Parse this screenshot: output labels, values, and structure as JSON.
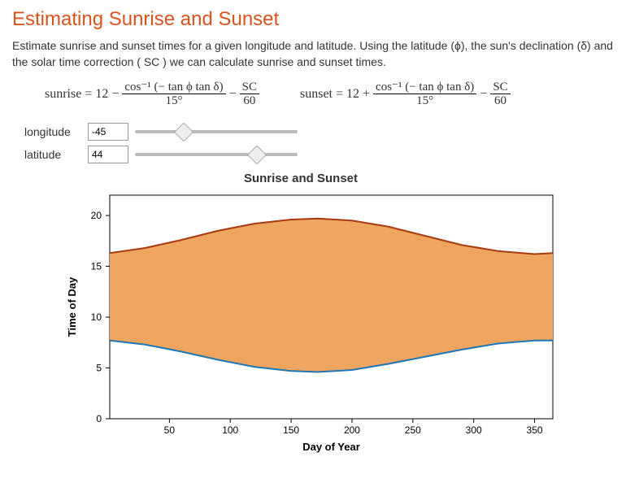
{
  "title": "Estimating Sunrise and Sunset",
  "description": "Estimate sunrise and sunset times for a given longitude and latitude.  Using the  latitude (ϕ), the sun's declination (δ) and the solar time correction ( SC ) we can calculate sunrise and sunset times.",
  "formula_sunrise_lhs": "sunrise = 12 −",
  "formula_sunset_lhs": "sunset = 12 +",
  "formula_frac1_num": "cos⁻¹ (− tan ϕ tan δ)",
  "formula_frac1_den": "15°",
  "formula_minus": "−",
  "formula_frac2_num": "SC",
  "formula_frac2_den": "60",
  "controls": {
    "longitude_label": "longitude",
    "longitude_value": "-45",
    "longitude_slider_pos": 30,
    "latitude_label": "latitude",
    "latitude_value": "44",
    "latitude_slider_pos": 75
  },
  "chart_data": {
    "type": "area",
    "title": "Sunrise and Sunset",
    "xlabel": "Day of Year",
    "ylabel": "Time of Day",
    "xlim": [
      1,
      365
    ],
    "ylim": [
      0,
      22
    ],
    "xticks": [
      50,
      100,
      150,
      200,
      250,
      300,
      350
    ],
    "yticks": [
      0,
      5,
      10,
      15,
      20
    ],
    "series": [
      {
        "name": "sunset",
        "color": "#a83a11",
        "x": [
          1,
          30,
          60,
          90,
          120,
          150,
          172,
          200,
          230,
          260,
          290,
          320,
          350,
          365
        ],
        "values": [
          16.3,
          16.8,
          17.6,
          18.5,
          19.2,
          19.6,
          19.7,
          19.5,
          18.9,
          18.0,
          17.1,
          16.5,
          16.2,
          16.3
        ]
      },
      {
        "name": "sunrise",
        "color": "#1f77b4",
        "x": [
          1,
          30,
          60,
          90,
          120,
          150,
          172,
          200,
          230,
          260,
          290,
          320,
          350,
          365
        ],
        "values": [
          7.7,
          7.3,
          6.6,
          5.8,
          5.1,
          4.7,
          4.6,
          4.8,
          5.4,
          6.1,
          6.8,
          7.4,
          7.7,
          7.7
        ]
      }
    ],
    "fill_color": "#eda55f"
  }
}
